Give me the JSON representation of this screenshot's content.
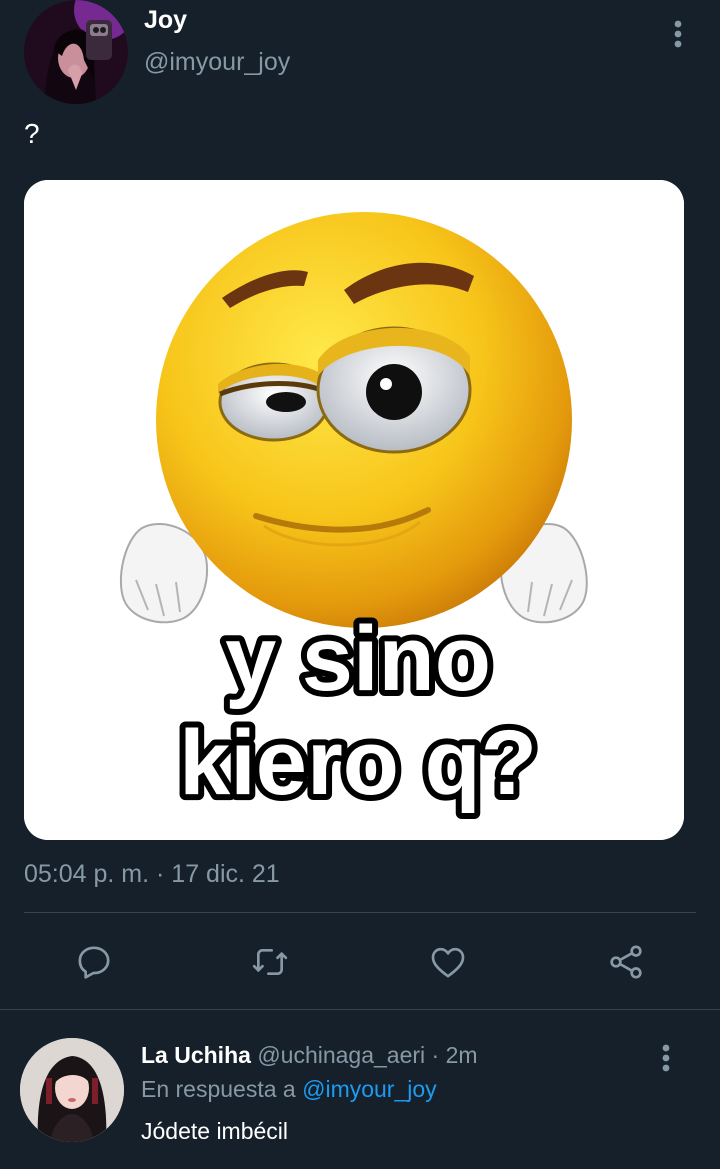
{
  "tweet": {
    "author_name": "Joy",
    "author_handle": "@imyour_joy",
    "text": "?",
    "image": {
      "meme_line_1": "y sino",
      "meme_line_2": "kiero q?"
    },
    "timestamp": "05:04 p. m. · 17 dic. 21",
    "more_icon": "more-vertical-icon"
  },
  "actions": [
    {
      "name": "reply",
      "icon": "reply-icon"
    },
    {
      "name": "retweet",
      "icon": "retweet-icon"
    },
    {
      "name": "like",
      "icon": "heart-icon"
    },
    {
      "name": "share",
      "icon": "share-icon"
    }
  ],
  "reply": {
    "author_name": "La Uchiha",
    "author_handle": "@uchinaga_aeri",
    "separator": " · ",
    "time": "2m",
    "replying_to_prefix": "En respuesta a ",
    "replying_to_handle": "@imyour_joy",
    "text": "Jódete imbécil"
  },
  "colors": {
    "background": "#15202b",
    "secondary_text": "#8899a6",
    "divider": "#38444d",
    "accent": "#1d9bf0"
  }
}
